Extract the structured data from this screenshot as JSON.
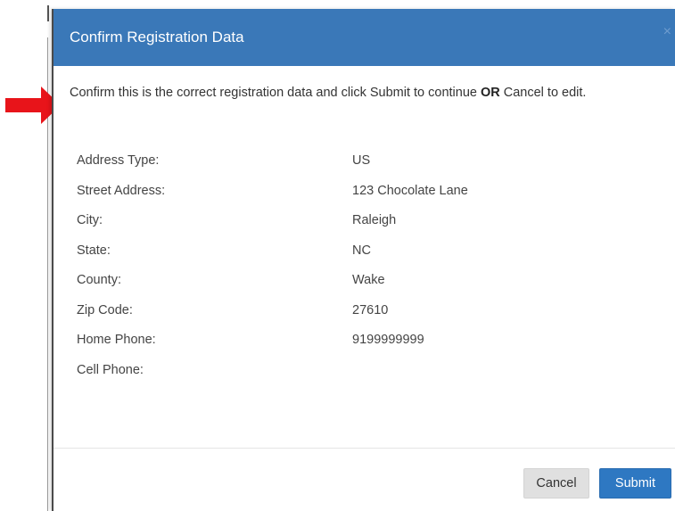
{
  "modal": {
    "title": "Confirm Registration Data",
    "close_symbol": "×",
    "intro_part1": "Confirm this is the correct registration data and click Submit to continue ",
    "intro_or": "OR",
    "intro_part2": " Cancel to edit."
  },
  "fields": [
    {
      "label": "Address Type:",
      "value": "US"
    },
    {
      "label": "Street Address:",
      "value": "123 Chocolate Lane"
    },
    {
      "label": "City:",
      "value": "Raleigh"
    },
    {
      "label": "State:",
      "value": "NC"
    },
    {
      "label": "County:",
      "value": "Wake"
    },
    {
      "label": "Zip Code:",
      "value": "27610"
    },
    {
      "label": "Home Phone:",
      "value": "9199999999"
    },
    {
      "label": "Cell Phone:",
      "value": ""
    }
  ],
  "buttons": {
    "cancel_label": "Cancel",
    "submit_label": "Submit"
  },
  "colors": {
    "header_bg": "#3a78b8",
    "submit_bg": "#2e78c2",
    "cancel_bg": "#e0e0e0",
    "arrow": "#e8141a"
  },
  "icons": {
    "arrow": "red-arrow-right-icon",
    "close": "close-icon"
  }
}
